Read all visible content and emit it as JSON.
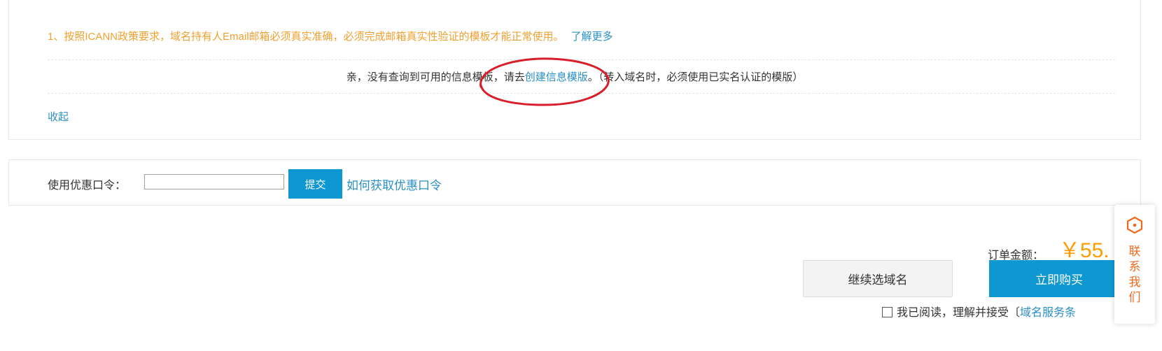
{
  "notice": {
    "rule_text": "1、按照ICANN政策要求，域名持有人Email邮箱必须真实准确，必须完成邮箱真实性验证的模板才能正常使用。",
    "learn_more_link": "了解更多",
    "empty_prefix": "亲，没有查询到可用的信息模板，请去",
    "create_link": "创建信息模版",
    "empty_suffix": "。（转入域名时，必须使用已实名认证的模版）",
    "collapse_link": "收起"
  },
  "coupon": {
    "label": "使用优惠口令：",
    "input_value": "",
    "submit_label": "提交",
    "help_link": "如何获取优惠口令"
  },
  "order": {
    "amount_label": "订单金额：",
    "amount_value": "￥55.",
    "continue_label": "继续选域名",
    "buy_label": "立即购买",
    "agree_text": "我已阅读，理解并接受〔",
    "terms_link": "域名服务条",
    "agreed": false
  },
  "contact_widget": {
    "label": "联系我们",
    "icon": "support-hexagon-icon"
  },
  "colors": {
    "notice_orange": "#f0a030",
    "link_blue": "#2a8fc4",
    "button_blue": "#0f97d1",
    "price_orange": "#ff9c00",
    "contact_orange": "#f06a1e",
    "annotation_red": "#d81e2a"
  }
}
